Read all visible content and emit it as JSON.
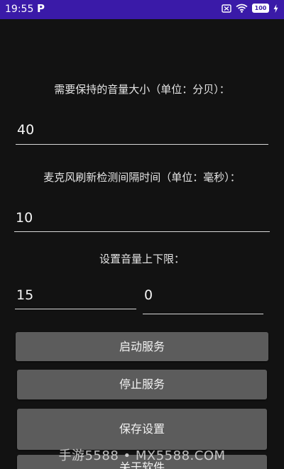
{
  "status_bar": {
    "time": "19:55",
    "app_glyph": "P",
    "battery": "100",
    "colors": {
      "background": "#3a1aa8",
      "text": "#ffffff"
    },
    "icons": [
      "no-sim-icon",
      "wifi-icon",
      "battery-icon",
      "charging-bolt-icon"
    ]
  },
  "volume": {
    "label": "需要保持的音量大小（单位：分贝）：",
    "value": "40"
  },
  "interval": {
    "label": "麦克风刷新检测间隔时间（单位：毫秒）：",
    "value": "10"
  },
  "limits": {
    "label": "设置音量上下限：",
    "upper_value": "15",
    "lower_value": "0"
  },
  "buttons": {
    "start": "启动服务",
    "stop": "停止服务",
    "save": "保存设置",
    "close": "关于软件"
  },
  "watermark": "手游5588 • MX5588.COM",
  "theme": {
    "background": "#121212",
    "button": "#5c5c5c",
    "text": "#e6e6e6"
  }
}
